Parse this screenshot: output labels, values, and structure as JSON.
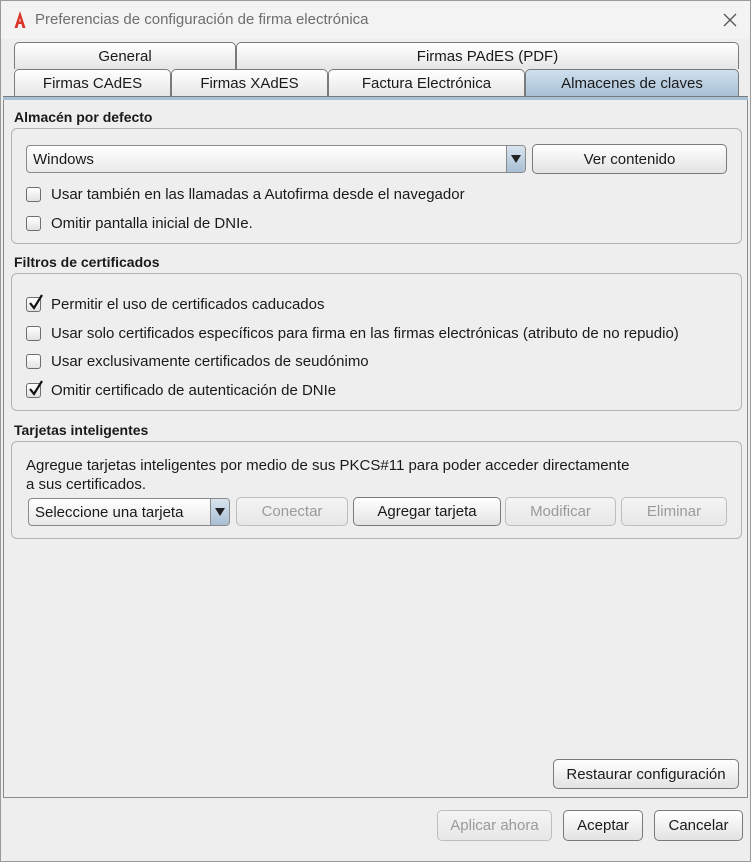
{
  "window": {
    "title": "Preferencias de configuración de firma electrónica"
  },
  "tabs": {
    "row1": [
      {
        "label": "General"
      },
      {
        "label": "Firmas PAdES (PDF)"
      }
    ],
    "row2": [
      {
        "label": "Firmas CAdES"
      },
      {
        "label": "Firmas XAdES"
      },
      {
        "label": "Factura Electrónica"
      },
      {
        "label": "Almacenes de claves"
      }
    ],
    "active": "Almacenes de claves"
  },
  "default_store": {
    "title": "Almacén por defecto",
    "store_value": "Windows",
    "view_button": "Ver contenido",
    "checkboxes": [
      {
        "label": "Usar también en las llamadas a Autofirma desde el navegador",
        "checked": false
      },
      {
        "label": "Omitir pantalla inicial de DNIe.",
        "checked": false
      }
    ]
  },
  "cert_filters": {
    "title": "Filtros de certificados",
    "checkboxes": [
      {
        "label": "Permitir el uso de certificados caducados",
        "checked": true
      },
      {
        "label": "Usar solo certificados específicos para firma en las firmas electrónicas (atributo de no repudio)",
        "checked": false
      },
      {
        "label": "Usar exclusivamente certificados de seudónimo",
        "checked": false
      },
      {
        "label": "Omitir certificado de autenticación de DNIe",
        "checked": true
      }
    ]
  },
  "smart_cards": {
    "title": "Tarjetas inteligentes",
    "description_line1": "Agregue tarjetas inteligentes por medio de sus PKCS#11 para poder acceder directamente",
    "description_line2": "a sus certificados.",
    "card_select": "Seleccione una tarjeta",
    "buttons": {
      "connect": "Conectar",
      "add": "Agregar tarjeta",
      "modify": "Modificar",
      "delete": "Eliminar"
    }
  },
  "restore_button": "Restaurar configuración",
  "footer": {
    "apply": "Aplicar ahora",
    "accept": "Aceptar",
    "cancel": "Cancelar"
  }
}
